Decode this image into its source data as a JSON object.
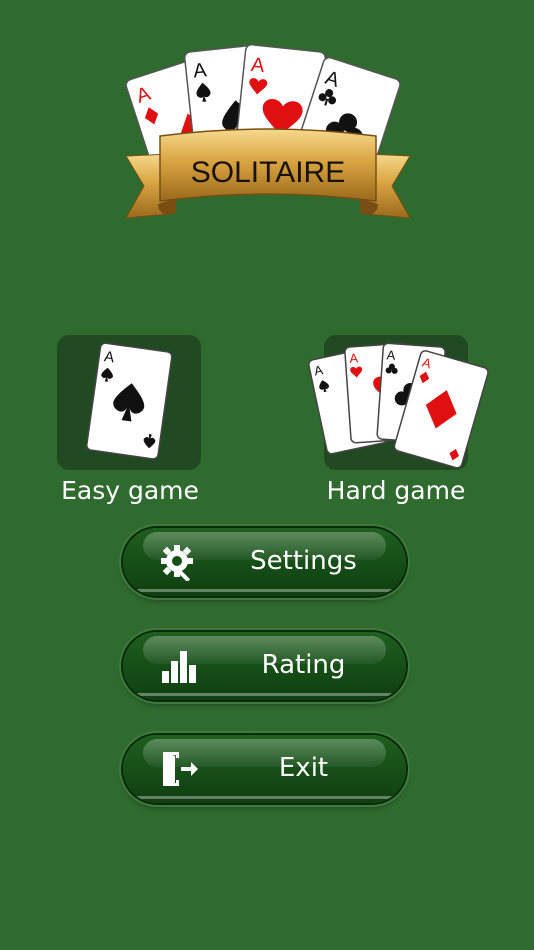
{
  "logo": {
    "title": "SOLITAIRE"
  },
  "modes": {
    "easy": {
      "label": "Easy game"
    },
    "hard": {
      "label": "Hard game"
    }
  },
  "card_text": {
    "ace": "A"
  },
  "menu": {
    "settings": {
      "label": "Settings",
      "icon": "gear-wrench-icon"
    },
    "rating": {
      "label": "Rating",
      "icon": "bar-chart-icon"
    },
    "exit": {
      "label": "Exit",
      "icon": "exit-door-icon"
    }
  },
  "colors": {
    "background": "#2f6a2e",
    "button": "#175017",
    "ribbon": "#d9a441",
    "red_suit": "#e01010"
  }
}
